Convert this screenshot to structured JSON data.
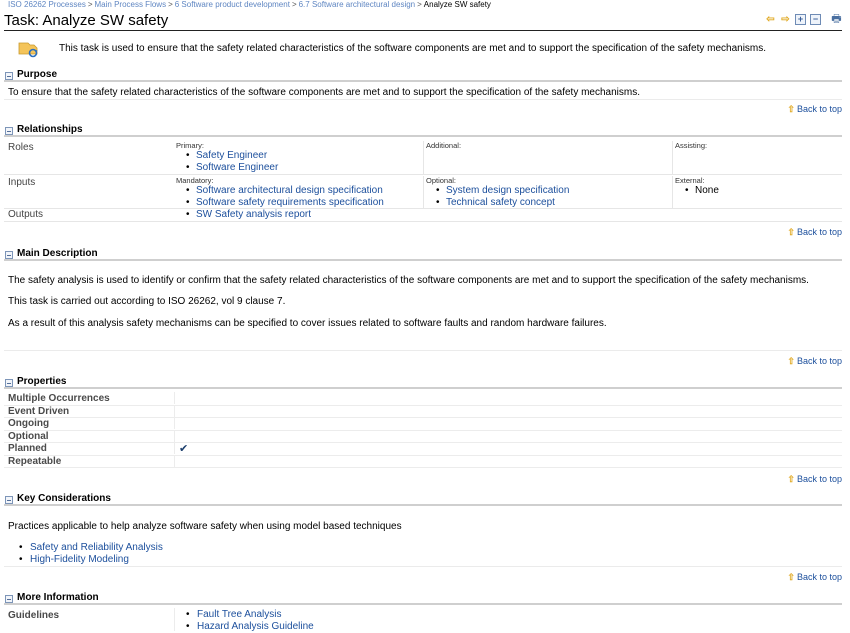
{
  "breadcrumb": {
    "items": [
      "ISO 26262 Processes",
      "Main Process Flows",
      "6 Software product development",
      "6.7 Software architectural design"
    ],
    "current": "Analyze SW safety",
    "separator": ">"
  },
  "header": {
    "title": "Task: Analyze SW safety",
    "toolbar": {
      "back_icon": "⇦",
      "forward_icon": "⇨",
      "expand_icon": "+",
      "collapse_icon": "−",
      "print_icon": "🖶"
    }
  },
  "intro": {
    "icon": "task-icon",
    "text": "This task is used to ensure that the safety related characteristics of the software components are met and to support the specification of the safety mechanisms."
  },
  "back_to_top": "Back to top",
  "sections": {
    "purpose": {
      "title": "Purpose",
      "text": "To ensure that the safety related characteristics of the software components are met and to support the specification of the safety mechanisms."
    },
    "relationships": {
      "title": "Relationships",
      "roles": {
        "label": "Roles",
        "primary_caption": "Primary:",
        "primary": [
          "Safety Engineer",
          "Software Engineer"
        ],
        "additional_caption": "Additional:",
        "additional": [],
        "assisting_caption": "Assisting:",
        "assisting": []
      },
      "inputs": {
        "label": "Inputs",
        "mandatory_caption": "Mandatory:",
        "mandatory": [
          "Software architectural design specification",
          "Software safety requirements specification"
        ],
        "optional_caption": "Optional:",
        "optional": [
          "System design specification",
          "Technical safety concept"
        ],
        "external_caption": "External:",
        "external": [
          "None"
        ]
      },
      "outputs": {
        "label": "Outputs",
        "items": [
          "SW Safety analysis report"
        ]
      }
    },
    "main_description": {
      "title": "Main Description",
      "paragraphs": [
        "The safety analysis is used to identify or confirm that the safety related characteristics of the software components are met and to support the specification of the safety mechanisms.",
        "This task is carried out according to ISO 26262, vol 9 clause 7.",
        "As a result of this analysis safety mechanisms can be specified to cover issues related to software faults and random hardware failures."
      ]
    },
    "properties": {
      "title": "Properties",
      "rows": [
        {
          "label": "Multiple Occurrences",
          "value": ""
        },
        {
          "label": "Event Driven",
          "value": ""
        },
        {
          "label": "Ongoing",
          "value": ""
        },
        {
          "label": "Optional",
          "value": ""
        },
        {
          "label": "Planned",
          "value": "✔"
        },
        {
          "label": "Repeatable",
          "value": ""
        }
      ]
    },
    "key_considerations": {
      "title": "Key Considerations",
      "text": "Practices applicable to help analyze software safety when using model based techniques",
      "links": [
        "Safety and Reliability Analysis",
        "High-Fidelity Modeling"
      ]
    },
    "more_information": {
      "title": "More Information",
      "guidelines_label": "Guidelines",
      "guidelines": [
        "Fault Tree Analysis",
        "Hazard Analysis Guideline"
      ]
    }
  }
}
